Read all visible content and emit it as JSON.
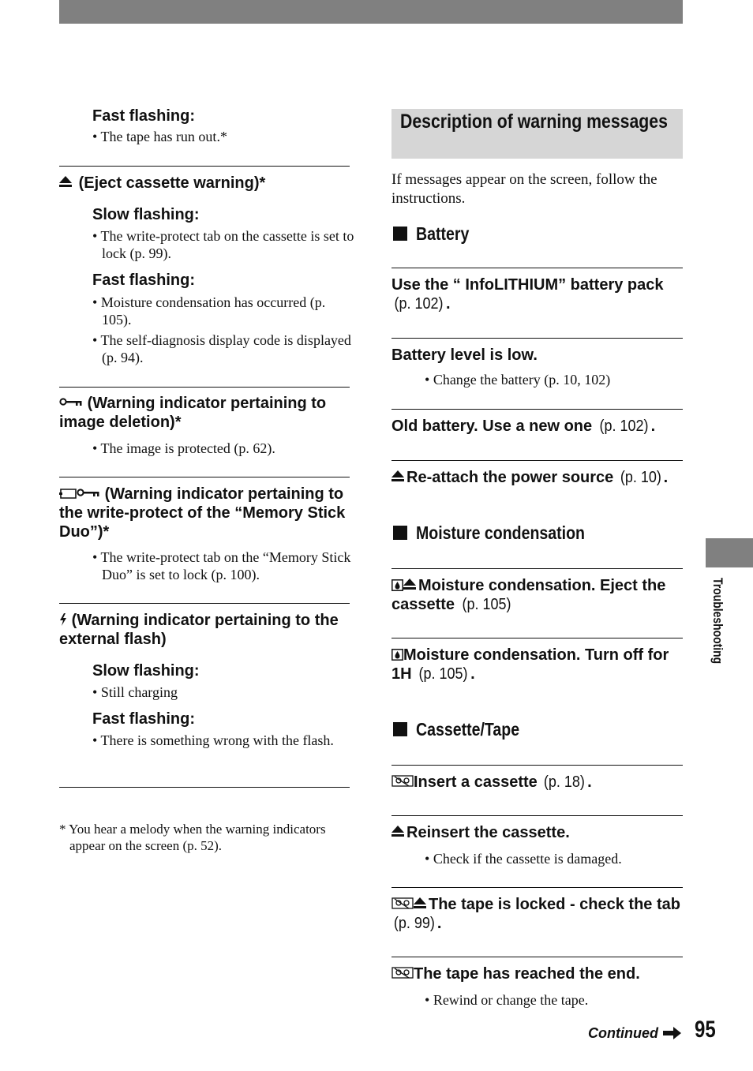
{
  "page": {
    "number": "95",
    "continued_label": "Continued",
    "side_tab_label": "Troubleshooting"
  },
  "left": {
    "tape_fast": {
      "heading": "Fast flashing:",
      "bullets": [
        "The tape has run out.*"
      ]
    },
    "eject_warning": {
      "icon": "eject-icon",
      "heading": "(Eject cassette warning)*",
      "slow": {
        "heading": "Slow flashing:",
        "bullets": [
          "The write-protect tab on the cassette is set to lock (p. 99)."
        ]
      },
      "fast": {
        "heading": "Fast flashing:",
        "bullets": [
          "Moisture condensation has occurred (p. 105).",
          "The self-diagnosis display code is displayed (p. 94)."
        ]
      }
    },
    "image_deletion": {
      "icon": "protect-key-icon",
      "heading": "(Warning indicator pertaining to image deletion)*",
      "bullets": [
        "The image is protected (p. 62)."
      ]
    },
    "memory_stick": {
      "icon": "memory-stick-protect-icon",
      "heading": "(Warning indicator pertaining to the write-protect of the “Memory Stick Duo”)*",
      "bullets": [
        "The write-protect tab on the “Memory Stick Duo” is set to lock (p. 100)."
      ]
    },
    "external_flash": {
      "icon": "flash-icon",
      "heading": "(Warning indicator pertaining to the external flash)",
      "slow": {
        "heading": "Slow flashing:",
        "bullets": [
          "Still charging"
        ]
      },
      "fast": {
        "heading": "Fast flashing:",
        "bullets": [
          "There is something wrong with the flash."
        ]
      }
    },
    "footnote": "* You hear a melody when the warning indicators appear on the screen (p. 52)."
  },
  "right": {
    "section_title": "Description of warning messages",
    "intro": "If messages appear on the screen, follow the instructions.",
    "categories": [
      {
        "title": "Battery",
        "items": [
          {
            "icons": [],
            "text": "Use the “ InfoLITHIUM” battery pack",
            "ref": "(p. 102)",
            "end": ".",
            "bullets": []
          },
          {
            "icons": [],
            "text": "Battery level is low.",
            "ref": "",
            "end": "",
            "bullets": [
              "Change the battery (p. 10, 102)"
            ]
          },
          {
            "icons": [],
            "text": "Old battery. Use a new one",
            "ref": "(p. 102)",
            "end": ".",
            "bullets": []
          },
          {
            "icons": [
              "eject-icon"
            ],
            "text": "Re-attach the power source",
            "ref": "(p. 10)",
            "end": ".",
            "bullets": []
          }
        ]
      },
      {
        "title": "Moisture condensation",
        "items": [
          {
            "icons": [
              "moisture-icon",
              "eject-icon"
            ],
            "text": "Moisture condensation. Eject the cassette",
            "ref": "(p. 105)",
            "end": "",
            "bullets": []
          },
          {
            "icons": [
              "moisture-icon"
            ],
            "text": "Moisture condensation. Turn off for 1H",
            "ref": "(p. 105)",
            "end": ".",
            "bullets": []
          }
        ]
      },
      {
        "title": "Cassette/Tape",
        "items": [
          {
            "icons": [
              "no-cassette-icon"
            ],
            "text": "Insert a cassette",
            "ref": "(p. 18)",
            "end": ".",
            "bullets": []
          },
          {
            "icons": [
              "eject-icon"
            ],
            "text": "Reinsert the cassette.",
            "ref": "",
            "end": "",
            "bullets": [
              "Check if the cassette is damaged."
            ]
          },
          {
            "icons": [
              "no-cassette-icon",
              "eject-icon"
            ],
            "text": "The tape is locked - check the tab",
            "ref": "(p. 99)",
            "end": ".",
            "bullets": []
          },
          {
            "icons": [
              "no-cassette-icon"
            ],
            "text": "The tape has reached the end.",
            "ref": "",
            "end": "",
            "bullets": [
              "Rewind or change the tape."
            ]
          }
        ]
      }
    ]
  },
  "colors": {
    "header_bar": "#808080",
    "section_box": "#d6d6d6",
    "text": "#111111"
  }
}
